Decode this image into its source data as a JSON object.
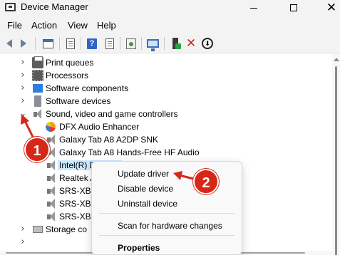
{
  "window": {
    "title": "Device Manager",
    "icon": "device-manager-icon"
  },
  "menu": [
    "File",
    "Action",
    "View",
    "Help"
  ],
  "toolbar": {
    "buttons": [
      "back-arrow-icon",
      "forward-arrow-icon",
      "console-tree-icon",
      "properties-icon",
      "help-icon",
      "scan-hardware-icon",
      "monitor-icon",
      "add-driver-icon",
      "uninstall-x-icon",
      "download-driver-icon"
    ]
  },
  "tree": {
    "categories": {
      "print_queues": "Print queues",
      "processors": "Processors",
      "software_components": "Software components",
      "software_devices": "Software devices",
      "sound": "Sound, video and game controllers",
      "storage": "Storage co"
    },
    "sound_children": {
      "dfx": "DFX Audio Enhancer",
      "galaxy_a2dp": "Galaxy Tab A8 A2DP SNK",
      "galaxy_hf": "Galaxy Tab A8 Hands-Free HF Audio",
      "intel": "Intel(R) D",
      "realtek": "Realtek A",
      "srs1": "SRS-XB1",
      "srs2": "SRS-XB1",
      "srs3": "SRS-XB1"
    }
  },
  "context_menu": {
    "update_driver": "Update driver",
    "disable_device": "Disable device",
    "uninstall_device": "Uninstall device",
    "scan_changes": "Scan for hardware changes",
    "properties": "Properties"
  },
  "annotations": {
    "step1": "1",
    "step2": "2",
    "color": "#d62718"
  }
}
